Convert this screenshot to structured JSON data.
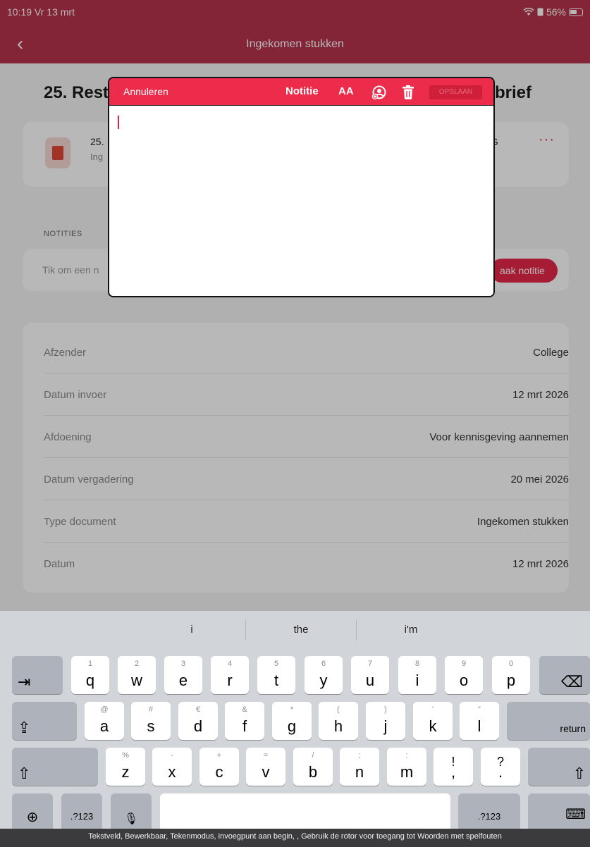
{
  "status": {
    "time": "10:19  Vr 13 mrt",
    "battery": "56%"
  },
  "nav": {
    "title": "Ingekomen stukken",
    "back_glyph": "‹"
  },
  "document": {
    "title_visible": "25. Rest",
    "title_tail": "brief",
    "file_name_visible": "25.",
    "file_sub_visible": "Ing",
    "file_name_tail": "/G",
    "more_glyph": "···"
  },
  "notes": {
    "label": "NOTITIES",
    "placeholder_visible": "Tik om een n",
    "button_visible": "aak notitie"
  },
  "meta": [
    {
      "label": "Afzender",
      "value": "College"
    },
    {
      "label": "Datum invoer",
      "value": "12 mrt 2026"
    },
    {
      "label": "Afdoening",
      "value": "Voor kennisgeving aannemen"
    },
    {
      "label": "Datum vergadering",
      "value": "20 mei 2026"
    },
    {
      "label": "Type document",
      "value": "Ingekomen stukken"
    },
    {
      "label": "Datum",
      "value": "12 mrt 2026"
    }
  ],
  "dialog": {
    "cancel": "Annuleren",
    "title": "Notitie",
    "font_size_label": "AA",
    "save": "OPSLAAN",
    "accent": "#ec2c4a"
  },
  "keyboard": {
    "suggestions": [
      "i",
      "the",
      "i'm"
    ],
    "row1": [
      {
        "sec": "1",
        "main": "q"
      },
      {
        "sec": "2",
        "main": "w"
      },
      {
        "sec": "3",
        "main": "e"
      },
      {
        "sec": "4",
        "main": "r"
      },
      {
        "sec": "5",
        "main": "t"
      },
      {
        "sec": "6",
        "main": "y"
      },
      {
        "sec": "7",
        "main": "u"
      },
      {
        "sec": "8",
        "main": "i"
      },
      {
        "sec": "9",
        "main": "o"
      },
      {
        "sec": "0",
        "main": "p"
      }
    ],
    "row2": [
      {
        "sec": "@",
        "main": "a"
      },
      {
        "sec": "#",
        "main": "s"
      },
      {
        "sec": "€",
        "main": "d"
      },
      {
        "sec": "&",
        "main": "f"
      },
      {
        "sec": "*",
        "main": "g"
      },
      {
        "sec": "(",
        "main": "h"
      },
      {
        "sec": ")",
        "main": "j"
      },
      {
        "sec": "'",
        "main": "k"
      },
      {
        "sec": "\"",
        "main": "l"
      }
    ],
    "row3": [
      {
        "sec": "%",
        "main": "z"
      },
      {
        "sec": "-",
        "main": "x"
      },
      {
        "sec": "+",
        "main": "c"
      },
      {
        "sec": "=",
        "main": "v"
      },
      {
        "sec": "/",
        "main": "b"
      },
      {
        "sec": ";",
        "main": "n"
      },
      {
        "sec": ":",
        "main": "m"
      },
      {
        "sec": "!",
        "main": ","
      },
      {
        "sec": "?",
        "main": "."
      }
    ],
    "tab_glyph": "⇥",
    "delete_glyph": "⌫",
    "capslock_glyph": "⇪",
    "shift_glyph": "⇧",
    "return_label": "return",
    "globe_glyph": "⊕",
    "numbers_label": ".?123",
    "mic_glyph": "🎙",
    "hide_keyboard_glyph": "⌨"
  },
  "voiceover_caption": "Tekstveld, Bewerkbaar, Tekenmodus, invoegpunt aan begin, , Gebruik de rotor voor toegang tot Woorden met spelfouten"
}
